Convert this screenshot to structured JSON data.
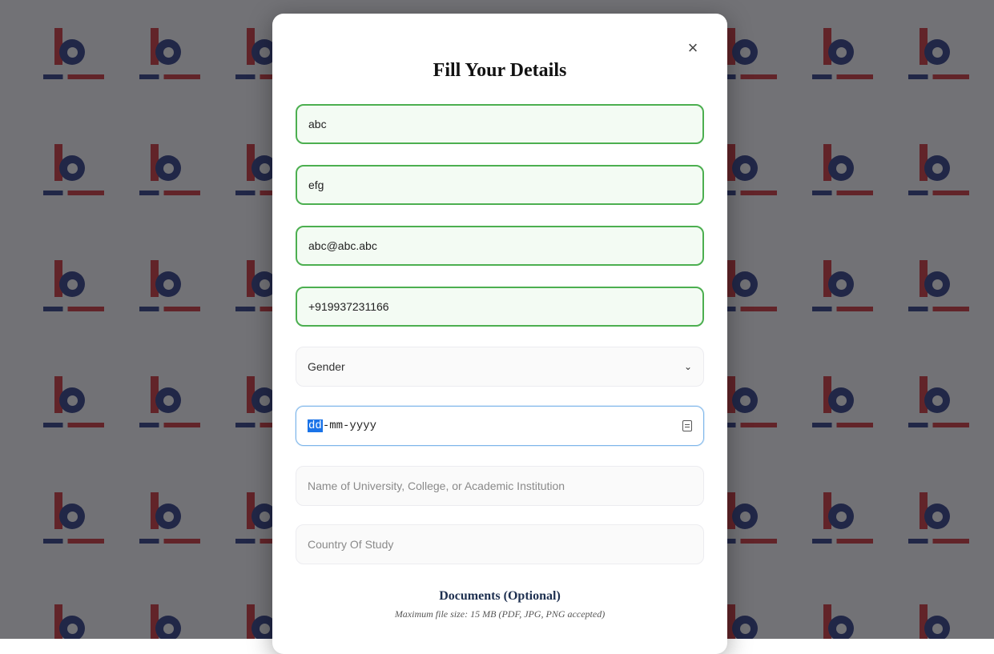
{
  "background": {
    "logo_name": "bank-logo-icon",
    "dim_color": "#23232a"
  },
  "modal": {
    "title": "Fill Your Details",
    "close_icon": "×",
    "fields": {
      "first_name": "abc",
      "last_name": "efg",
      "email": "abc@abc.abc",
      "phone": "+919937231166",
      "gender": "Gender",
      "dob_day": "dd",
      "dob_rest": "-mm-yyyy",
      "university_placeholder": "Name of University, College, or Academic Institution",
      "country_placeholder": "Country Of Study"
    },
    "documents": {
      "title": "Documents (Optional)",
      "note": "Maximum file size: 15 MB (PDF, JPG, PNG accepted)"
    }
  },
  "colors": {
    "valid_border": "#4caf50",
    "focus_border": "#7eb6ea",
    "logo_red": "#c9262c",
    "logo_blue": "#1f2f7a"
  }
}
